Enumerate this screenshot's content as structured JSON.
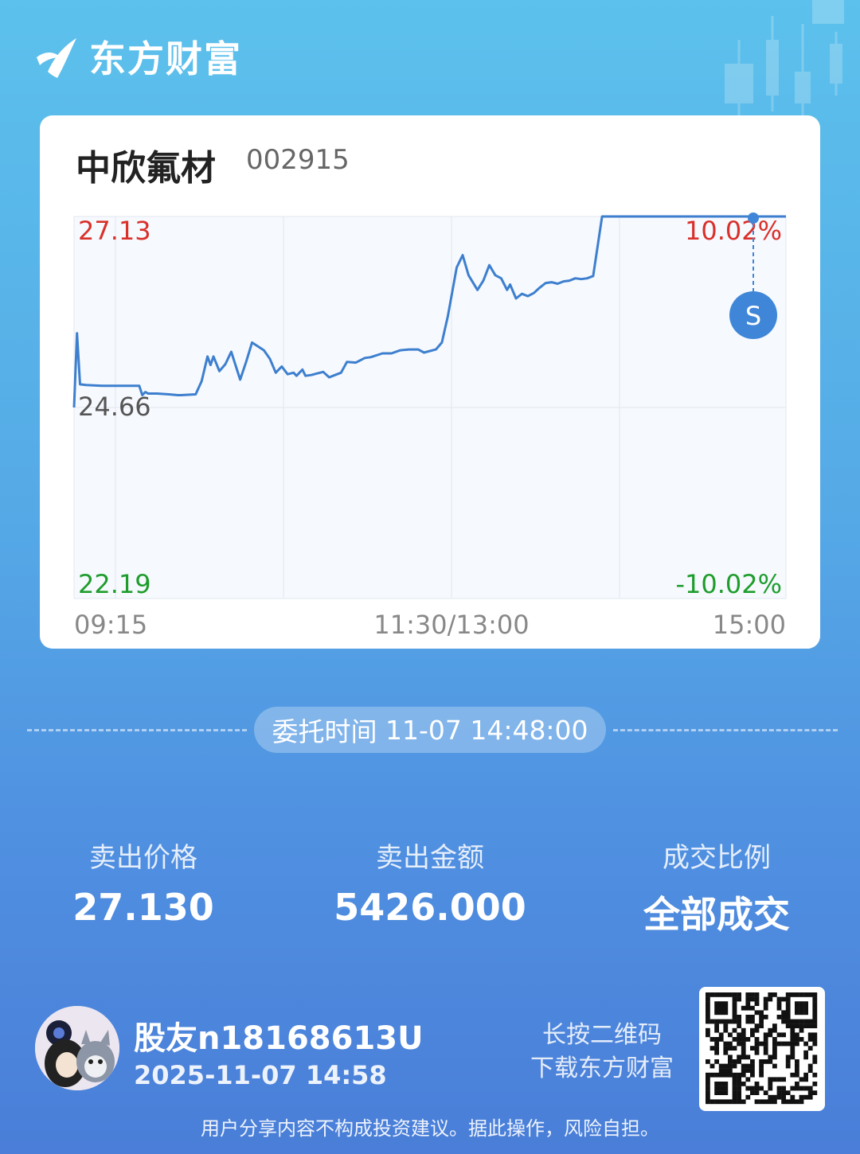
{
  "brand": {
    "name": "东方财富",
    "icon": "brand-swoosh-icon"
  },
  "stock": {
    "name": "中欣氟材",
    "code": "002915"
  },
  "chart_data": {
    "type": "line",
    "y_labels": {
      "high": "27.13",
      "mid": "24.66",
      "low": "22.19"
    },
    "pct_labels": {
      "high": "10.02%",
      "low": "-10.02%"
    },
    "x_labels": [
      "09:15",
      "11:30/13:00",
      "15:00"
    ],
    "ylim": [
      22.19,
      27.13
    ],
    "x_session_minutes": 240,
    "series": [
      {
        "points": [
          [
            0,
            24.66
          ],
          [
            1,
            25.62
          ],
          [
            2,
            24.96
          ],
          [
            4,
            24.95
          ],
          [
            10,
            24.94
          ],
          [
            22,
            24.94
          ],
          [
            23,
            24.82
          ],
          [
            24,
            24.86
          ],
          [
            25,
            24.84
          ],
          [
            28,
            24.84
          ],
          [
            32,
            24.83
          ],
          [
            35,
            24.82
          ],
          [
            36,
            24.82
          ],
          [
            41,
            24.83
          ],
          [
            43,
            25.0
          ],
          [
            45,
            25.32
          ],
          [
            46,
            25.21
          ],
          [
            47,
            25.32
          ],
          [
            49,
            25.13
          ],
          [
            51,
            25.22
          ],
          [
            53,
            25.38
          ],
          [
            56,
            25.02
          ],
          [
            58,
            25.25
          ],
          [
            60,
            25.5
          ],
          [
            64,
            25.4
          ],
          [
            66,
            25.29
          ],
          [
            68,
            25.11
          ],
          [
            70,
            25.19
          ],
          [
            72,
            25.09
          ],
          [
            74,
            25.11
          ],
          [
            75,
            25.07
          ],
          [
            77,
            25.15
          ],
          [
            78,
            25.07
          ],
          [
            80,
            25.08
          ],
          [
            82,
            25.1
          ],
          [
            84,
            25.12
          ],
          [
            86,
            25.05
          ],
          [
            88,
            25.08
          ],
          [
            90,
            25.11
          ],
          [
            92,
            25.25
          ],
          [
            95,
            25.24
          ],
          [
            98,
            25.3
          ],
          [
            100,
            25.31
          ],
          [
            104,
            25.36
          ],
          [
            107,
            25.36
          ],
          [
            110,
            25.4
          ],
          [
            113,
            25.41
          ],
          [
            116,
            25.41
          ],
          [
            118,
            25.37
          ],
          [
            122,
            25.41
          ],
          [
            124,
            25.5
          ],
          [
            126,
            25.84
          ],
          [
            129,
            26.47
          ],
          [
            131,
            26.63
          ],
          [
            133,
            26.37
          ],
          [
            136,
            26.18
          ],
          [
            138,
            26.3
          ],
          [
            140,
            26.5
          ],
          [
            142,
            26.37
          ],
          [
            144,
            26.33
          ],
          [
            146,
            26.18
          ],
          [
            147,
            26.25
          ],
          [
            149,
            26.07
          ],
          [
            151,
            26.13
          ],
          [
            153,
            26.1
          ],
          [
            155,
            26.14
          ],
          [
            157,
            26.21
          ],
          [
            159,
            26.27
          ],
          [
            161,
            26.28
          ],
          [
            163,
            26.26
          ],
          [
            165,
            26.29
          ],
          [
            167,
            26.3
          ],
          [
            169,
            26.33
          ],
          [
            171,
            26.32
          ],
          [
            173,
            26.33
          ],
          [
            175,
            26.36
          ],
          [
            178,
            27.13
          ],
          [
            240,
            27.13
          ]
        ]
      }
    ],
    "markers": [
      {
        "label": "S",
        "x": 240,
        "y": 27.13
      }
    ],
    "grid": true
  },
  "order": {
    "label": "委托时间",
    "time": "11-07 14:48:00"
  },
  "stats": [
    {
      "label": "卖出价格",
      "value": "27.130"
    },
    {
      "label": "卖出金额",
      "value": "5426.000"
    },
    {
      "label": "成交比例",
      "value": "全部成交"
    }
  ],
  "user": {
    "name": "股友n18168613U",
    "time": "2025-11-07 14:58",
    "avatar": "cartoon-avatar"
  },
  "qr": {
    "hint_line1": "长按二维码",
    "hint_line2": "下载东方财富",
    "icon": "qr-code"
  },
  "disclaimer": "用户分享内容不构成投资建议。据此操作，风险自担。",
  "colors": {
    "up": "#d9302a",
    "down": "#1e9d2b",
    "line": "#3d7fce",
    "marker": "#3f86d8"
  }
}
